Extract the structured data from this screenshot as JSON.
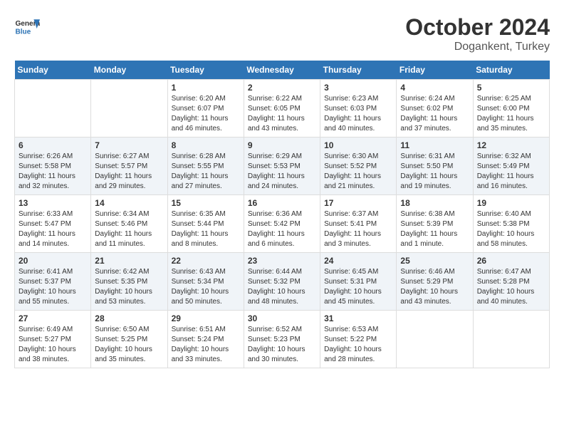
{
  "header": {
    "logo_line1": "General",
    "logo_line2": "Blue",
    "month": "October 2024",
    "location": "Dogankent, Turkey"
  },
  "days_of_week": [
    "Sunday",
    "Monday",
    "Tuesday",
    "Wednesday",
    "Thursday",
    "Friday",
    "Saturday"
  ],
  "weeks": [
    [
      {
        "day": "",
        "content": ""
      },
      {
        "day": "",
        "content": ""
      },
      {
        "day": "1",
        "content": "Sunrise: 6:20 AM\nSunset: 6:07 PM\nDaylight: 11 hours and 46 minutes."
      },
      {
        "day": "2",
        "content": "Sunrise: 6:22 AM\nSunset: 6:05 PM\nDaylight: 11 hours and 43 minutes."
      },
      {
        "day": "3",
        "content": "Sunrise: 6:23 AM\nSunset: 6:03 PM\nDaylight: 11 hours and 40 minutes."
      },
      {
        "day": "4",
        "content": "Sunrise: 6:24 AM\nSunset: 6:02 PM\nDaylight: 11 hours and 37 minutes."
      },
      {
        "day": "5",
        "content": "Sunrise: 6:25 AM\nSunset: 6:00 PM\nDaylight: 11 hours and 35 minutes."
      }
    ],
    [
      {
        "day": "6",
        "content": "Sunrise: 6:26 AM\nSunset: 5:58 PM\nDaylight: 11 hours and 32 minutes."
      },
      {
        "day": "7",
        "content": "Sunrise: 6:27 AM\nSunset: 5:57 PM\nDaylight: 11 hours and 29 minutes."
      },
      {
        "day": "8",
        "content": "Sunrise: 6:28 AM\nSunset: 5:55 PM\nDaylight: 11 hours and 27 minutes."
      },
      {
        "day": "9",
        "content": "Sunrise: 6:29 AM\nSunset: 5:53 PM\nDaylight: 11 hours and 24 minutes."
      },
      {
        "day": "10",
        "content": "Sunrise: 6:30 AM\nSunset: 5:52 PM\nDaylight: 11 hours and 21 minutes."
      },
      {
        "day": "11",
        "content": "Sunrise: 6:31 AM\nSunset: 5:50 PM\nDaylight: 11 hours and 19 minutes."
      },
      {
        "day": "12",
        "content": "Sunrise: 6:32 AM\nSunset: 5:49 PM\nDaylight: 11 hours and 16 minutes."
      }
    ],
    [
      {
        "day": "13",
        "content": "Sunrise: 6:33 AM\nSunset: 5:47 PM\nDaylight: 11 hours and 14 minutes."
      },
      {
        "day": "14",
        "content": "Sunrise: 6:34 AM\nSunset: 5:46 PM\nDaylight: 11 hours and 11 minutes."
      },
      {
        "day": "15",
        "content": "Sunrise: 6:35 AM\nSunset: 5:44 PM\nDaylight: 11 hours and 8 minutes."
      },
      {
        "day": "16",
        "content": "Sunrise: 6:36 AM\nSunset: 5:42 PM\nDaylight: 11 hours and 6 minutes."
      },
      {
        "day": "17",
        "content": "Sunrise: 6:37 AM\nSunset: 5:41 PM\nDaylight: 11 hours and 3 minutes."
      },
      {
        "day": "18",
        "content": "Sunrise: 6:38 AM\nSunset: 5:39 PM\nDaylight: 11 hours and 1 minute."
      },
      {
        "day": "19",
        "content": "Sunrise: 6:40 AM\nSunset: 5:38 PM\nDaylight: 10 hours and 58 minutes."
      }
    ],
    [
      {
        "day": "20",
        "content": "Sunrise: 6:41 AM\nSunset: 5:37 PM\nDaylight: 10 hours and 55 minutes."
      },
      {
        "day": "21",
        "content": "Sunrise: 6:42 AM\nSunset: 5:35 PM\nDaylight: 10 hours and 53 minutes."
      },
      {
        "day": "22",
        "content": "Sunrise: 6:43 AM\nSunset: 5:34 PM\nDaylight: 10 hours and 50 minutes."
      },
      {
        "day": "23",
        "content": "Sunrise: 6:44 AM\nSunset: 5:32 PM\nDaylight: 10 hours and 48 minutes."
      },
      {
        "day": "24",
        "content": "Sunrise: 6:45 AM\nSunset: 5:31 PM\nDaylight: 10 hours and 45 minutes."
      },
      {
        "day": "25",
        "content": "Sunrise: 6:46 AM\nSunset: 5:29 PM\nDaylight: 10 hours and 43 minutes."
      },
      {
        "day": "26",
        "content": "Sunrise: 6:47 AM\nSunset: 5:28 PM\nDaylight: 10 hours and 40 minutes."
      }
    ],
    [
      {
        "day": "27",
        "content": "Sunrise: 6:49 AM\nSunset: 5:27 PM\nDaylight: 10 hours and 38 minutes."
      },
      {
        "day": "28",
        "content": "Sunrise: 6:50 AM\nSunset: 5:25 PM\nDaylight: 10 hours and 35 minutes."
      },
      {
        "day": "29",
        "content": "Sunrise: 6:51 AM\nSunset: 5:24 PM\nDaylight: 10 hours and 33 minutes."
      },
      {
        "day": "30",
        "content": "Sunrise: 6:52 AM\nSunset: 5:23 PM\nDaylight: 10 hours and 30 minutes."
      },
      {
        "day": "31",
        "content": "Sunrise: 6:53 AM\nSunset: 5:22 PM\nDaylight: 10 hours and 28 minutes."
      },
      {
        "day": "",
        "content": ""
      },
      {
        "day": "",
        "content": ""
      }
    ]
  ]
}
